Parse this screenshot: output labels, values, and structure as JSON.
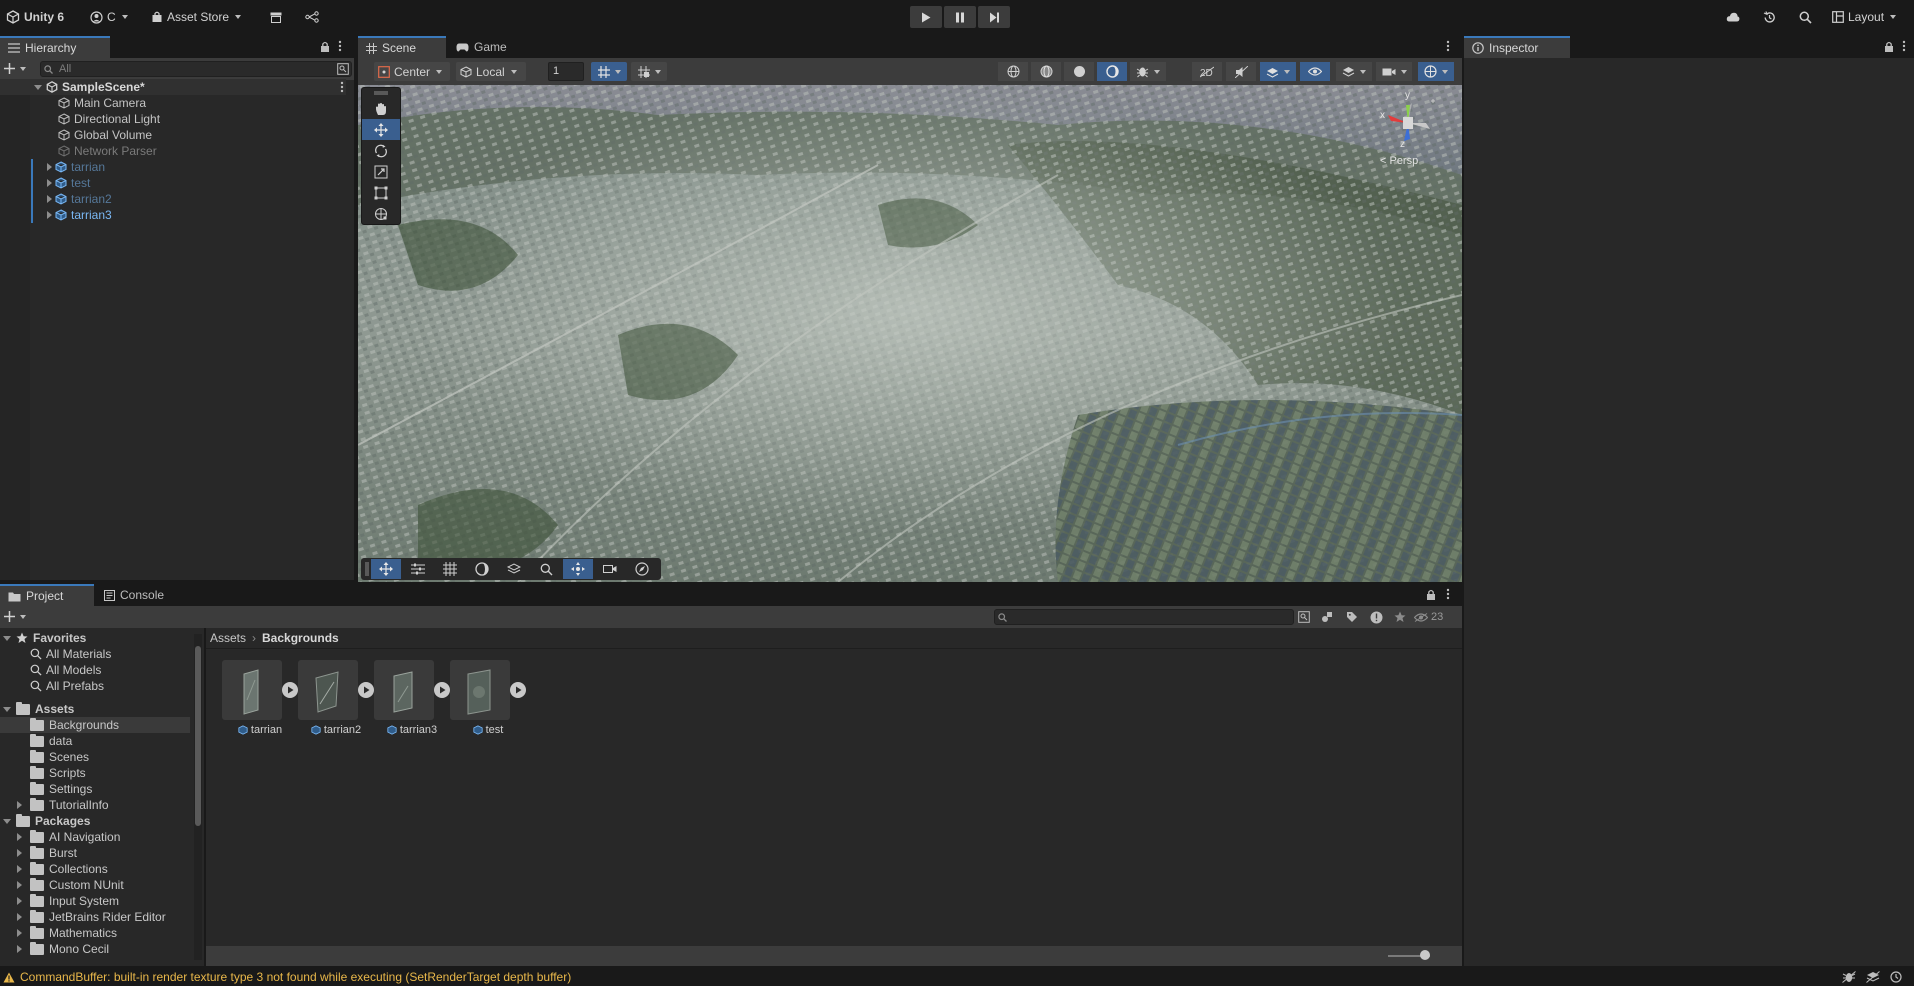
{
  "toolbar": {
    "app_label": "Unity 6",
    "account_label": "C",
    "asset_store_label": "Asset Store",
    "layout_label": "Layout"
  },
  "hierarchy": {
    "tab_label": "Hierarchy",
    "search_placeholder": "All",
    "scene_name": "SampleScene*",
    "items": [
      {
        "label": "Main Camera"
      },
      {
        "label": "Directional Light"
      },
      {
        "label": "Global Volume"
      },
      {
        "label": "Network Parser"
      },
      {
        "label": "tarrian"
      },
      {
        "label": "test"
      },
      {
        "label": "tarrian2"
      },
      {
        "label": "tarrian3"
      }
    ]
  },
  "scene": {
    "tabs": [
      {
        "label": "Scene"
      },
      {
        "label": "Game"
      }
    ],
    "pivot_label": "Center",
    "space_label": "Local",
    "grid_value": "1",
    "gizmo_y": "y",
    "gizmo_x": "x",
    "gizmo_z": "z",
    "persp_label": "< Persp"
  },
  "inspector": {
    "tab_label": "Inspector"
  },
  "project": {
    "tabs": [
      {
        "label": "Project"
      },
      {
        "label": "Console"
      }
    ],
    "hidden_count": "23",
    "favorites_label": "Favorites",
    "favorites": [
      "All Materials",
      "All Models",
      "All Prefabs"
    ],
    "assets_label": "Assets",
    "asset_folders": [
      "Backgrounds",
      "data",
      "Scenes",
      "Scripts",
      "Settings",
      "TutorialInfo"
    ],
    "packages_label": "Packages",
    "packages": [
      "AI Navigation",
      "Burst",
      "Collections",
      "Custom NUnit",
      "Input System",
      "JetBrains Rider Editor",
      "Mathematics",
      "Mono Cecil"
    ],
    "breadcrumb": [
      "Assets",
      "Backgrounds"
    ],
    "assets": [
      "tarrian",
      "tarrian2",
      "tarrian3",
      "test"
    ]
  },
  "status": {
    "message": "CommandBuffer: built-in render texture type 3 not found while executing  (SetRenderTarget depth buffer)"
  },
  "colors": {
    "accent": "#3a79bb",
    "prefab_blue": "#7ab8f5",
    "warning": "#e8b74a"
  }
}
